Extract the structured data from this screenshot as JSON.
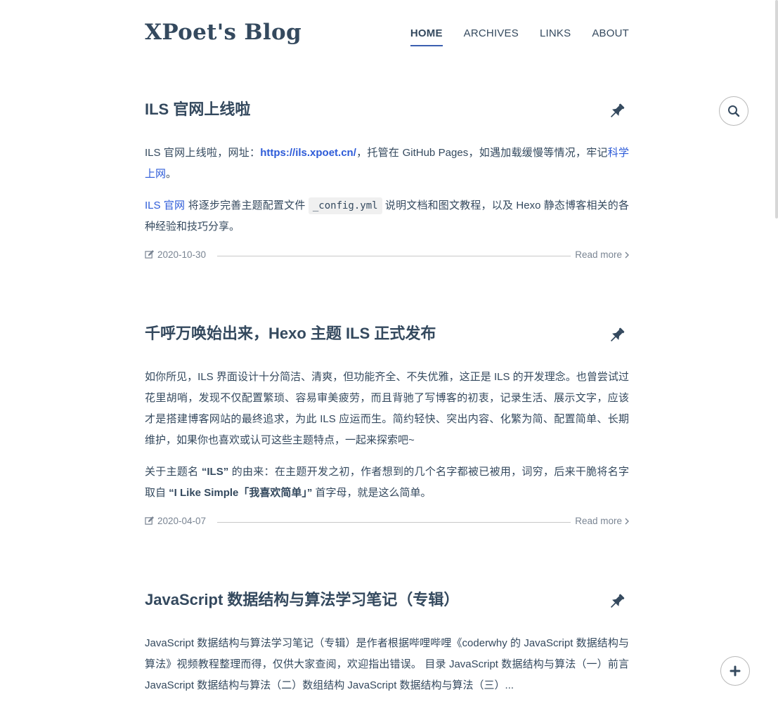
{
  "site": {
    "title": "XPoet's Blog",
    "nav": [
      "HOME",
      "ARCHIVES",
      "LINKS",
      "ABOUT"
    ],
    "active_nav": "HOME"
  },
  "posts": [
    {
      "title": "ILS 官网上线啦",
      "pinned": true,
      "p1_text1": "ILS 官网上线啦，网址：",
      "p1_link": "https://ils.xpoet.cn/",
      "p1_text2": "，托管在 GitHub Pages，如遇加载缓慢等情况，牢记",
      "p1_link2": "科学上网",
      "p1_text3": "。",
      "p2_link": "ILS 官网",
      "p2_text1": " 将逐步完善主题配置文件 ",
      "p2_code": "_config.yml",
      "p2_text2": " 说明文档和图文教程，以及 Hexo 静态博客相关的各种经验和技巧分享。",
      "date": "2020-10-30",
      "read_more": "Read more"
    },
    {
      "title": "千呼万唤始出来，Hexo 主题 ILS 正式发布",
      "pinned": true,
      "p1": "如你所见，ILS 界面设计十分简洁、清爽，但功能齐全、不失优雅，这正是 ILS 的开发理念。也曾尝试过花里胡哨，发现不仅配置繁琐、容易审美疲劳，而且背驰了写博客的初衷，记录生活、展示文字，应该才是搭建博客网站的最终追求，为此 ILS 应运而生。简约轻快、突出内容、化繁为简、配置简单、长期维护，如果你也喜欢或认可这些主题特点，一起来探索吧~",
      "p2_text1": "关于主题名 ",
      "p2_bold1": "“ILS”",
      "p2_text2": " 的由来：在主题开发之初，作者想到的几个名字都被已被用，词穷，后来干脆将名字取自 ",
      "p2_bold2": "“I Like Simple「我喜欢简单」”",
      "p2_text3": " 首字母，就是这么简单。",
      "date": "2020-04-07",
      "read_more": "Read more"
    },
    {
      "title": "JavaScript 数据结构与算法学习笔记（专辑）",
      "pinned": true,
      "p1": "JavaScript 数据结构与算法学习笔记（专辑）是作者根据哔哩哔哩《coderwhy 的 JavaScript 数据结构与算法》视频教程整理而得，仅供大家查阅，欢迎指出错误。 目录 JavaScript 数据结构与算法（一）前言 JavaScript 数据结构与算法（二）数组结构 JavaScript 数据结构与算法（三）..."
    }
  ],
  "icons": {
    "pin": "pin-icon",
    "edit": "edit-icon",
    "search": "search-icon",
    "plus": "plus-icon",
    "chevron": "chevron-right-icon"
  },
  "colors": {
    "text": "#34495e",
    "link": "#2d5bd8",
    "nav_underline": "#3b5fb0",
    "meta": "#7a8593"
  }
}
